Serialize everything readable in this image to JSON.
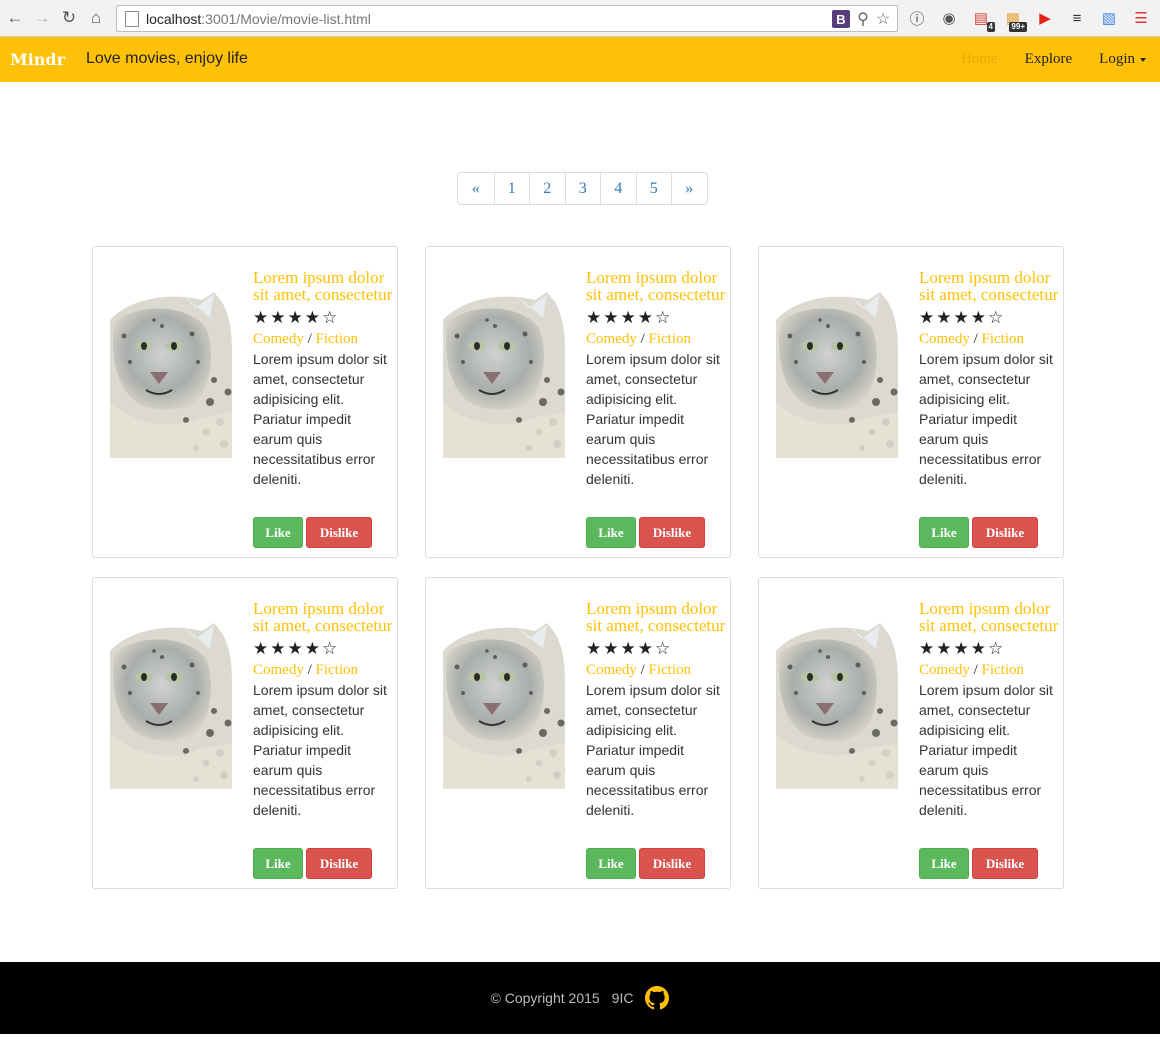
{
  "browser": {
    "url_host": "localhost",
    "url_rest": ":3001/Movie/movie-list.html",
    "bootstrap_badge": "B",
    "ext_badges": [
      "4",
      "99+"
    ]
  },
  "navbar": {
    "brand": "Mindr",
    "tagline": "Love movies, enjoy life",
    "items": [
      {
        "label": "Home",
        "active": true
      },
      {
        "label": "Explore",
        "active": false
      },
      {
        "label": "Login",
        "active": false
      }
    ]
  },
  "pagination": [
    "«",
    "1",
    "2",
    "3",
    "4",
    "5",
    "»"
  ],
  "movies": [
    {
      "title": "Lorem ipsum dolor sit amet, consectetur",
      "rating": 4,
      "stars": "★★★★☆",
      "genres": [
        "Comedy",
        "Fiction"
      ],
      "description": "Lorem ipsum dolor sit amet, consectetur adipisicing elit. Pariatur impedit earum quis necessitatibus error deleniti.",
      "like": "Like",
      "dislike": "Dislike"
    },
    {
      "title": "Lorem ipsum dolor sit amet, consectetur",
      "rating": 4,
      "stars": "★★★★☆",
      "genres": [
        "Comedy",
        "Fiction"
      ],
      "description": "Lorem ipsum dolor sit amet, consectetur adipisicing elit. Pariatur impedit earum quis necessitatibus error deleniti.",
      "like": "Like",
      "dislike": "Dislike"
    },
    {
      "title": "Lorem ipsum dolor sit amet, consectetur",
      "rating": 4,
      "stars": "★★★★☆",
      "genres": [
        "Comedy",
        "Fiction"
      ],
      "description": "Lorem ipsum dolor sit amet, consectetur adipisicing elit. Pariatur impedit earum quis necessitatibus error deleniti.",
      "like": "Like",
      "dislike": "Dislike"
    },
    {
      "title": "Lorem ipsum dolor sit amet, consectetur",
      "rating": 4,
      "stars": "★★★★☆",
      "genres": [
        "Comedy",
        "Fiction"
      ],
      "description": "Lorem ipsum dolor sit amet, consectetur adipisicing elit. Pariatur impedit earum quis necessitatibus error deleniti.",
      "like": "Like",
      "dislike": "Dislike"
    },
    {
      "title": "Lorem ipsum dolor sit amet, consectetur",
      "rating": 4,
      "stars": "★★★★☆",
      "genres": [
        "Comedy",
        "Fiction"
      ],
      "description": "Lorem ipsum dolor sit amet, consectetur adipisicing elit. Pariatur impedit earum quis necessitatibus error deleniti.",
      "like": "Like",
      "dislike": "Dislike"
    },
    {
      "title": "Lorem ipsum dolor sit amet, consectetur",
      "rating": 4,
      "stars": "★★★★☆",
      "genres": [
        "Comedy",
        "Fiction"
      ],
      "description": "Lorem ipsum dolor sit amet, consectetur adipisicing elit. Pariatur impedit earum quis necessitatibus error deleniti.",
      "like": "Like",
      "dislike": "Dislike"
    }
  ],
  "footer": {
    "copyright": "© Copyright 2015",
    "team": "9IC"
  },
  "colors": {
    "navbar": "#ffc107",
    "link": "#337ab7",
    "like": "#5cb85c",
    "dislike": "#d9534f",
    "footer": "#000000"
  },
  "icons": {
    "thumbnail": "snow-leopard-image",
    "footer": "github-icon"
  }
}
